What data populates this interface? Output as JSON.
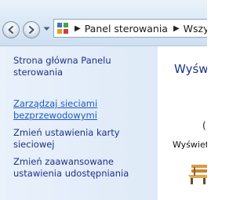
{
  "navigation": {
    "back_icon": "back-arrow-icon",
    "forward_icon": "forward-arrow-icon",
    "history_icon": "chevron-down-icon"
  },
  "address_bar": {
    "location_icon": "control-panel-icon",
    "breadcrumbs": [
      {
        "label": "Panel sterowania"
      },
      {
        "label": "Wszystkie elementy Panelu sterowania"
      }
    ]
  },
  "task_pane": {
    "links": [
      {
        "label": "Strona główna Panelu sterowania"
      },
      {
        "label": "Zarządzaj sieciami bezprzewodowymi"
      },
      {
        "label": "Zmień ustawienia karty sieciowej"
      },
      {
        "label": "Zmień zaawansowane ustawienia udostępniania"
      }
    ]
  },
  "main": {
    "title": "Wyświetl podstawowe informacje o sieci",
    "paren_fragment": "(",
    "active_label": "Wyświetl",
    "network_icon": "park-bench-icon"
  },
  "colors": {
    "link": "#1e3287",
    "link_hover": "#1e5cbf",
    "task_pane_bg": "#dfeaf8"
  }
}
